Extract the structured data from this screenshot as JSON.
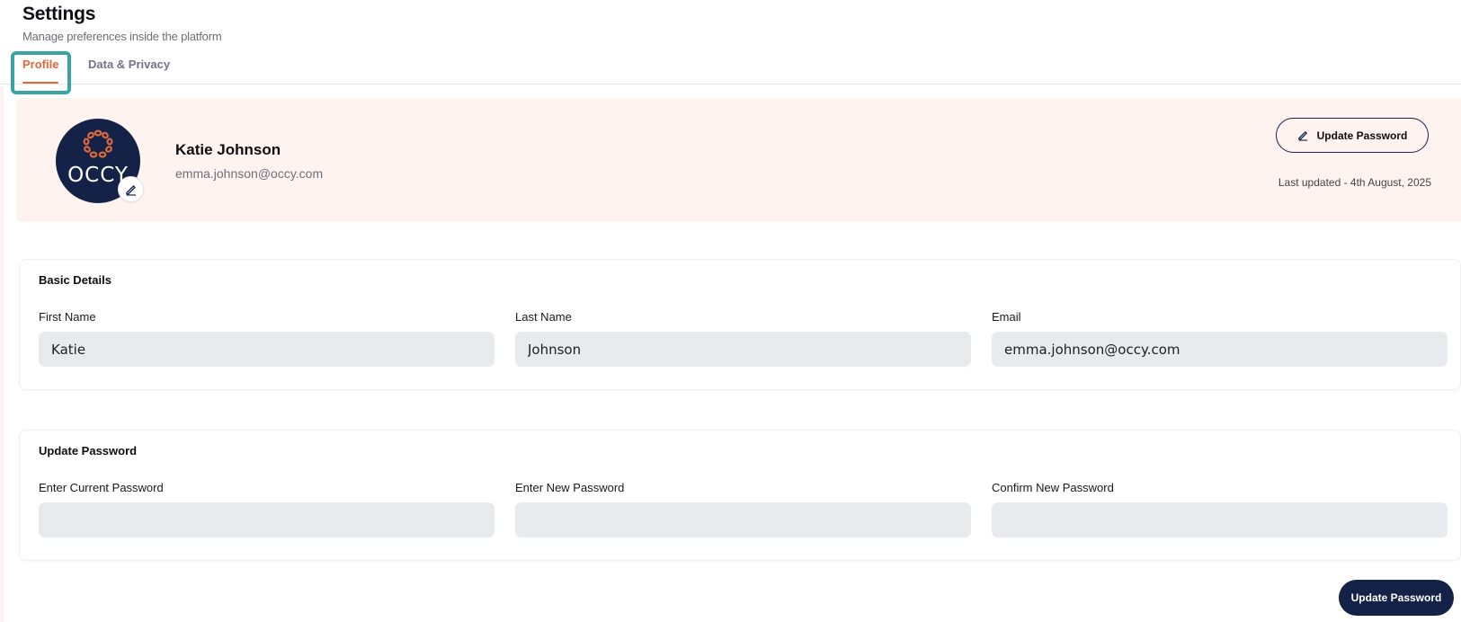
{
  "header": {
    "title": "Settings",
    "subtitle": "Manage preferences inside the platform"
  },
  "tabs": [
    {
      "label": "Profile",
      "active": true
    },
    {
      "label": "Data & Privacy",
      "active": false
    }
  ],
  "profile": {
    "avatar_text": "OCCY",
    "avatar_logo_icon": "chain-ring-logo",
    "name": "Katie Johnson",
    "email": "emma.johnson@occy.com",
    "update_password_label": "Update Password",
    "last_updated": "Last updated - 4th August, 2025"
  },
  "basic_details": {
    "title": "Basic Details",
    "fields": [
      {
        "label": "First Name",
        "value": "Katie"
      },
      {
        "label": "Last Name",
        "value": "Johnson"
      },
      {
        "label": "Email",
        "value": "emma.johnson@occy.com"
      }
    ]
  },
  "update_password": {
    "title": "Update Password",
    "fields": [
      {
        "label": "Enter Current Password",
        "value": ""
      },
      {
        "label": "Enter New Password",
        "value": ""
      },
      {
        "label": "Confirm New Password",
        "value": ""
      }
    ],
    "submit_label": "Update Password"
  },
  "colors": {
    "accent": "#e0693a",
    "navy": "#152247",
    "profile_card_bg": "#fef3ef",
    "input_bg": "#e8eaed",
    "highlight": "#3aa3a3"
  }
}
